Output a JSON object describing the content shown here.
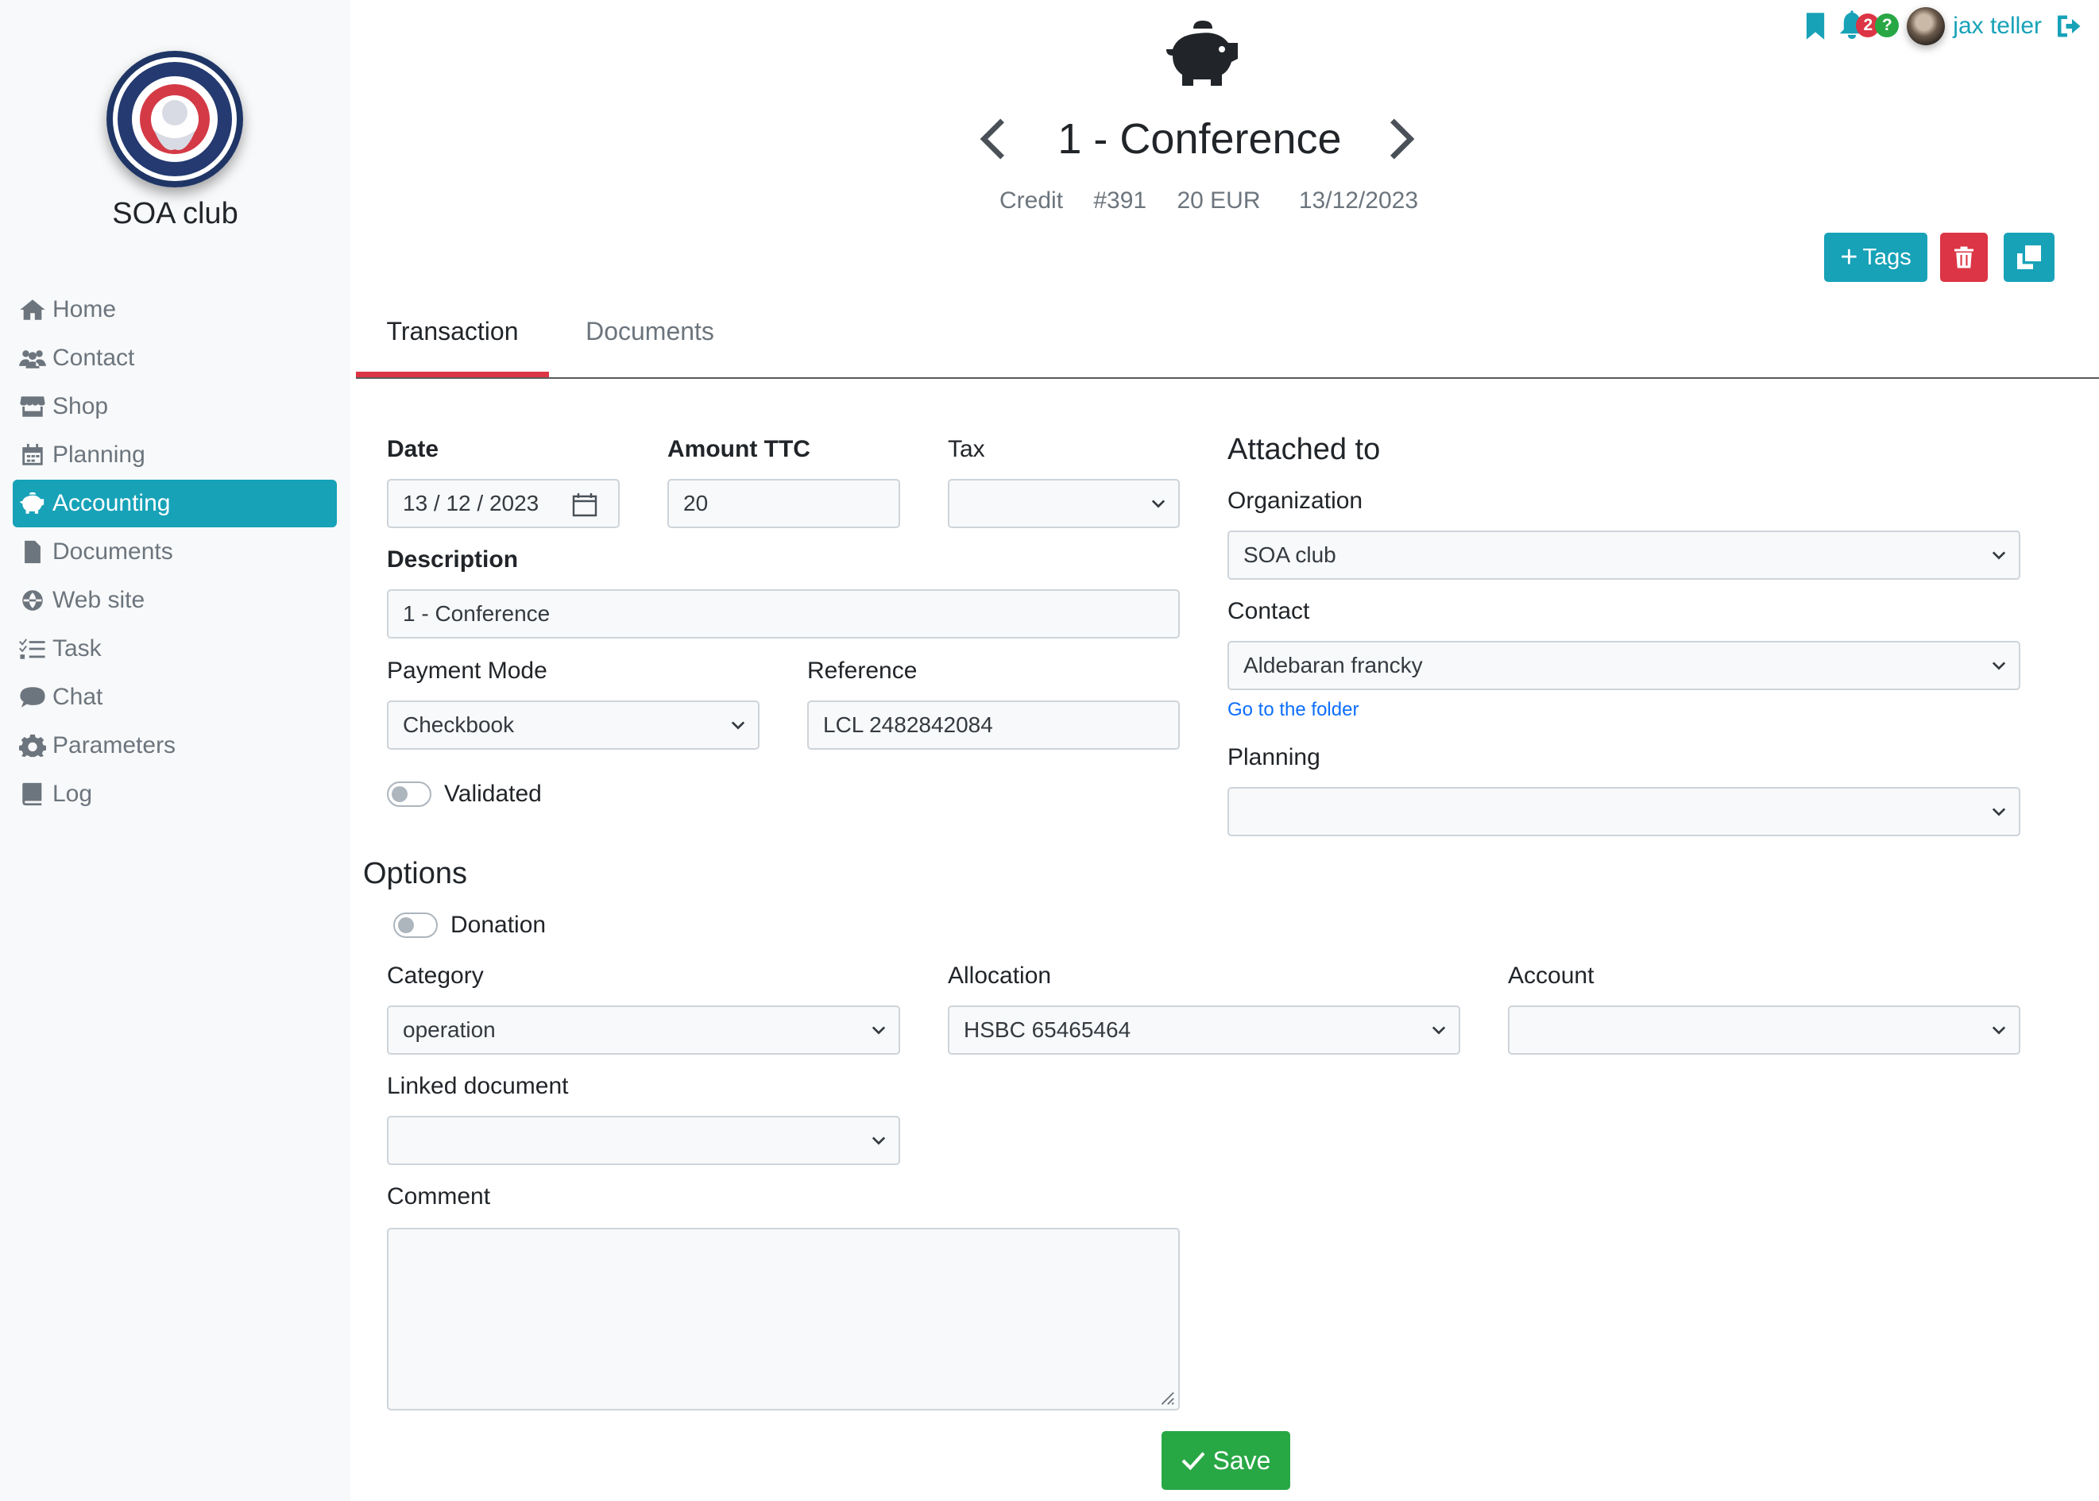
{
  "sidebar": {
    "club_name": "SOA club",
    "items": [
      {
        "label": "Home",
        "icon": "home-icon"
      },
      {
        "label": "Contact",
        "icon": "users-icon"
      },
      {
        "label": "Shop",
        "icon": "store-icon"
      },
      {
        "label": "Planning",
        "icon": "calendar-icon"
      },
      {
        "label": "Accounting",
        "icon": "piggy-bank-icon",
        "active": true
      },
      {
        "label": "Documents",
        "icon": "file-icon"
      },
      {
        "label": "Web site",
        "icon": "globe-icon"
      },
      {
        "label": "Task",
        "icon": "tasks-icon"
      },
      {
        "label": "Chat",
        "icon": "chat-icon"
      },
      {
        "label": "Parameters",
        "icon": "gear-icon"
      },
      {
        "label": "Log",
        "icon": "book-icon"
      }
    ]
  },
  "topbar": {
    "notifications_count": "2",
    "help_badge": "?",
    "username": "jax teller"
  },
  "header": {
    "title": "1 - Conference",
    "type": "Credit",
    "number": "#391",
    "amount": "20 EUR",
    "date": "13/12/2023"
  },
  "actions": {
    "tags_label": "Tags"
  },
  "tabs": {
    "transaction": "Transaction",
    "documents": "Documents"
  },
  "form": {
    "date_label": "Date",
    "date_value": "13 / 12 / 2023",
    "amount_label": "Amount TTC",
    "amount_value": "20",
    "tax_label": "Tax",
    "tax_value": "",
    "description_label": "Description",
    "description_value": "1 - Conference",
    "payment_mode_label": "Payment Mode",
    "payment_mode_value": "Checkbook",
    "reference_label": "Reference",
    "reference_value": "LCL 2482842084",
    "validated_label": "Validated"
  },
  "attached": {
    "heading": "Attached to",
    "organization_label": "Organization",
    "organization_value": "SOA club",
    "contact_label": "Contact",
    "contact_value": "Aldebaran francky",
    "folder_link": "Go to the folder",
    "planning_label": "Planning",
    "planning_value": ""
  },
  "options": {
    "heading": "Options",
    "donation_label": "Donation",
    "category_label": "Category",
    "category_value": "operation",
    "allocation_label": "Allocation",
    "allocation_value": "HSBC 65465464",
    "account_label": "Account",
    "account_value": "",
    "linked_document_label": "Linked document",
    "linked_document_value": "",
    "comment_label": "Comment"
  },
  "save_label": "Save",
  "colors": {
    "accent": "#17a2b8",
    "danger": "#dc3545",
    "success": "#28a745",
    "link": "#0d6efd"
  }
}
